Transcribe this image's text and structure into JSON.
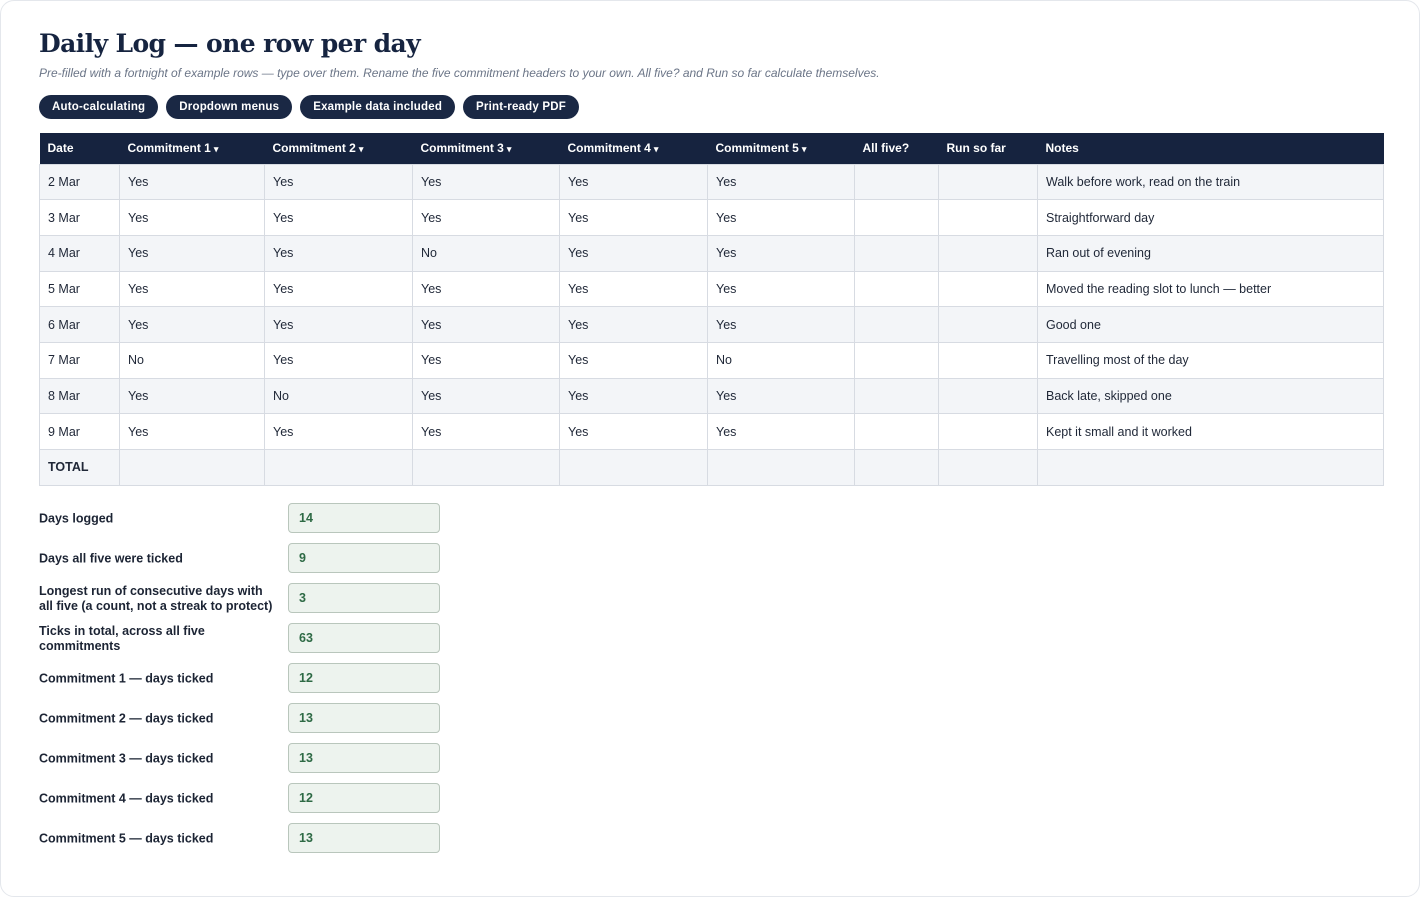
{
  "header": {
    "title": "Daily Log — one row per day",
    "subtitle": "Pre-filled with a fortnight of example rows — type over them. Rename the five commitment headers to your own. All five? and Run so far calculate themselves."
  },
  "pills": [
    "Auto-calculating",
    "Dropdown menus",
    "Example data included",
    "Print-ready PDF"
  ],
  "table": {
    "columns": [
      "Date",
      "Commitment 1",
      "Commitment 2",
      "Commitment 3",
      "Commitment 4",
      "Commitment 5",
      "All five?",
      "Run so far",
      "Notes"
    ],
    "dropdown_caret": "▾",
    "rows": [
      [
        "2 Mar",
        "Yes",
        "Yes",
        "Yes",
        "Yes",
        "Yes",
        "",
        "",
        "Walk before work, read on the train"
      ],
      [
        "3 Mar",
        "Yes",
        "Yes",
        "Yes",
        "Yes",
        "Yes",
        "",
        "",
        "Straightforward day"
      ],
      [
        "4 Mar",
        "Yes",
        "Yes",
        "No",
        "Yes",
        "Yes",
        "",
        "",
        "Ran out of evening"
      ],
      [
        "5 Mar",
        "Yes",
        "Yes",
        "Yes",
        "Yes",
        "Yes",
        "",
        "",
        "Moved the reading slot to lunch — better"
      ],
      [
        "6 Mar",
        "Yes",
        "Yes",
        "Yes",
        "Yes",
        "Yes",
        "",
        "",
        "Good one"
      ],
      [
        "7 Mar",
        "No",
        "Yes",
        "Yes",
        "Yes",
        "No",
        "",
        "",
        "Travelling most of the day"
      ],
      [
        "8 Mar",
        "Yes",
        "No",
        "Yes",
        "Yes",
        "Yes",
        "",
        "",
        "Back late, skipped one"
      ],
      [
        "9 Mar",
        "Yes",
        "Yes",
        "Yes",
        "Yes",
        "Yes",
        "",
        "",
        "Kept it small and it worked"
      ]
    ],
    "total_label": "TOTAL"
  },
  "stats": [
    {
      "label": "Days logged",
      "value": "14"
    },
    {
      "label": "Days all five were ticked",
      "value": "9"
    },
    {
      "label": "Longest run of consecutive days with all five (a count, not a streak to protect)",
      "value": "3"
    },
    {
      "label": "Ticks in total, across all five commitments",
      "value": "63"
    },
    {
      "label": "Commitment 1 — days ticked",
      "value": "12"
    },
    {
      "label": "Commitment 2 — days ticked",
      "value": "13"
    },
    {
      "label": "Commitment 3 — days ticked",
      "value": "13"
    },
    {
      "label": "Commitment 4 — days ticked",
      "value": "12"
    },
    {
      "label": "Commitment 5 — days ticked",
      "value": "13"
    }
  ]
}
